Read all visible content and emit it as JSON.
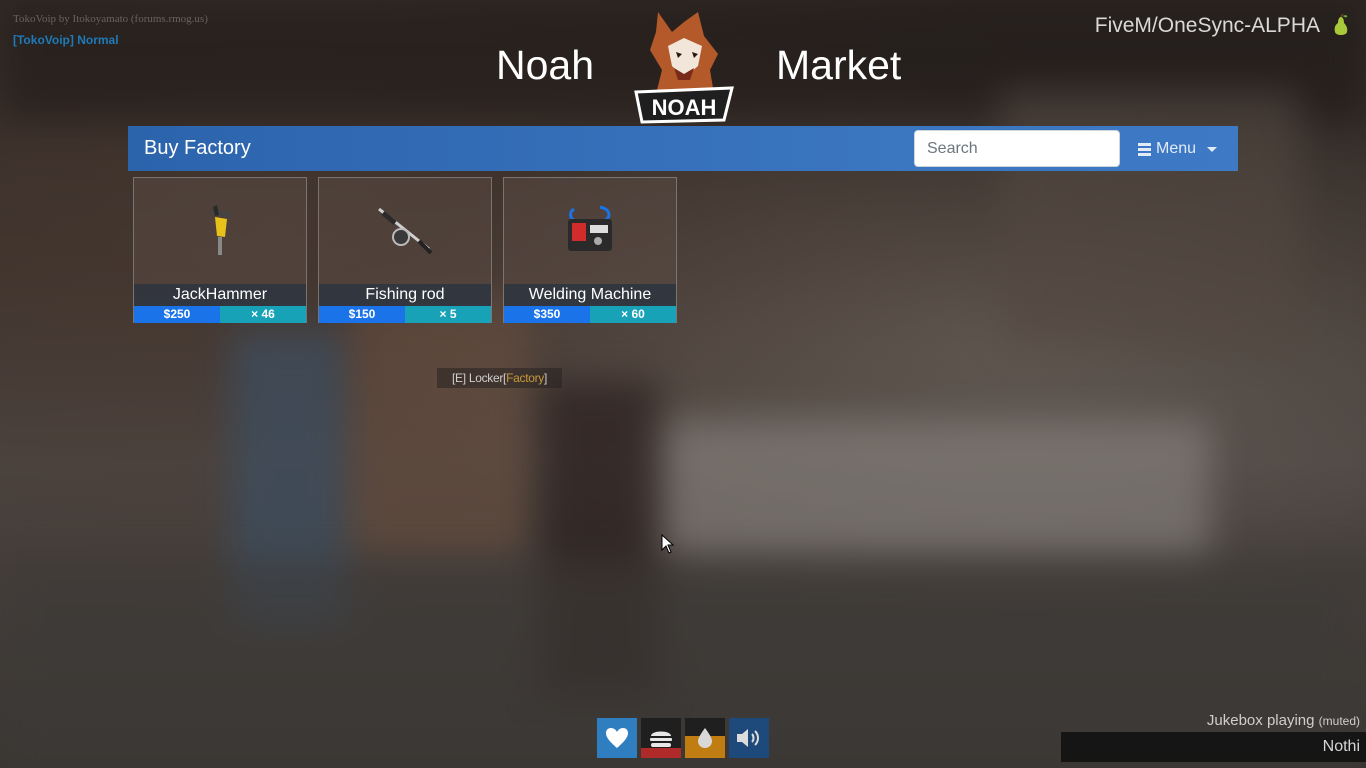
{
  "voip": {
    "credit": "TokoVoip by Itokoyamato (forums.rmog.us)",
    "status": "[TokoVoip] Normal"
  },
  "server": {
    "name": "FiveM/OneSync-ALPHA",
    "icon": "pear-icon"
  },
  "header": {
    "title_left": "Noah",
    "title_right": "Market",
    "logo_text": "NOAH"
  },
  "shop": {
    "title": "Buy Factory",
    "search_placeholder": "Search",
    "menu_label": "Menu"
  },
  "items": [
    {
      "name": "JackHammer",
      "price": "$250",
      "stock": "× 46",
      "icon": "jackhammer-icon"
    },
    {
      "name": "Fishing rod",
      "price": "$150",
      "stock": "× 5",
      "icon": "fishing-rod-icon"
    },
    {
      "name": "Welding Machine",
      "price": "$350",
      "stock": "× 60",
      "icon": "welding-machine-icon"
    }
  ],
  "locker_hint": {
    "key": "[E]",
    "label": "Locker",
    "open_bracket": "[",
    "place": "Factory",
    "close_bracket": "]"
  },
  "hud": {
    "health": 1.0,
    "hunger": 0.25,
    "thirst": 0.55,
    "voice_icon": "speaker-icon"
  },
  "jukebox": {
    "label": "Jukebox playing",
    "muted": "(muted)",
    "track": "Nothi"
  },
  "colors": {
    "shop_bar": "#3b76c1",
    "price": "#1a73e8",
    "stock": "#17a2b8",
    "hunger": "#b12a2a",
    "thirst": "#c07d11"
  }
}
